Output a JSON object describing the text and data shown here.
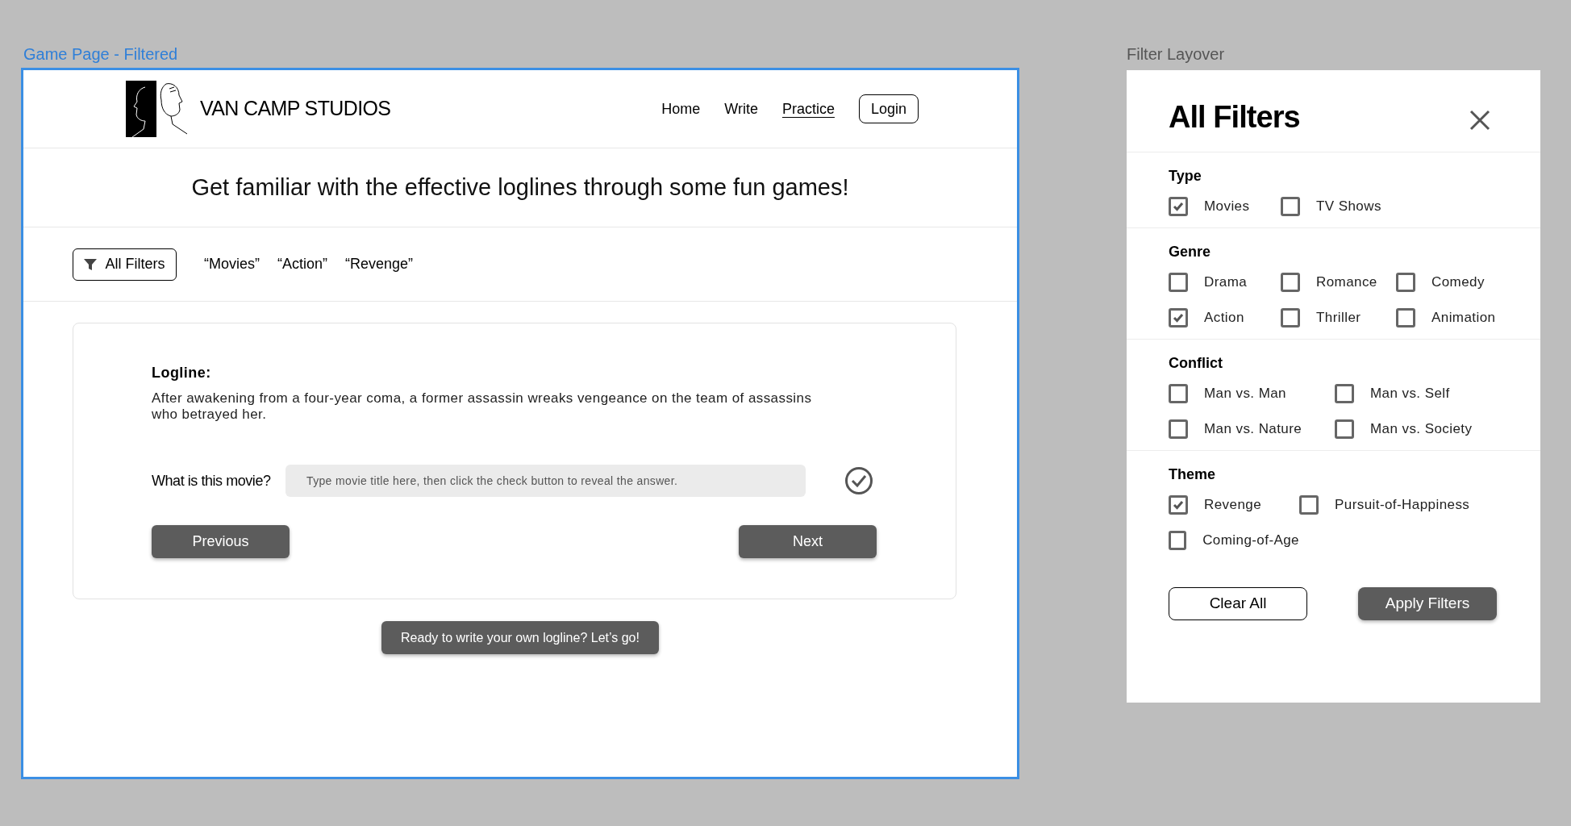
{
  "game_page": {
    "frame_label": "Game Page - Filtered",
    "header": {
      "brand": "VAN CAMP STUDIOS",
      "nav": [
        {
          "label": "Home",
          "selected": false
        },
        {
          "label": "Write",
          "selected": false
        },
        {
          "label": "Practice",
          "selected": true
        }
      ],
      "login": "Login"
    },
    "headline": "Get familiar with the effective loglines through some fun games!",
    "filter_bar": {
      "button": "All Filters",
      "tags": [
        "“Movies”",
        "“Action”",
        "“Revenge”"
      ]
    },
    "card": {
      "logline_label": "Logline:",
      "logline": "After awakening from a four-year coma, a former assassin wreaks vengeance on the team of assassins who betrayed her.",
      "question": "What is this movie?",
      "placeholder": "Type movie title here, then click the check button to reveal the answer.",
      "buttons": [
        "Previous",
        "Next"
      ]
    },
    "cta": "Ready to write your own logline? Let’s go!"
  },
  "filter_layover": {
    "frame_label": "Filter Layover",
    "title": "All Filters",
    "sections": [
      {
        "heading": "Type",
        "options": [
          {
            "label": "Movies",
            "checked": true
          },
          {
            "label": "TV Shows",
            "checked": false
          }
        ]
      },
      {
        "heading": "Genre",
        "options": [
          {
            "label": "Drama",
            "checked": false
          },
          {
            "label": "Romance",
            "checked": false
          },
          {
            "label": "Comedy",
            "checked": false
          },
          {
            "label": "Action",
            "checked": true
          },
          {
            "label": "Thriller",
            "checked": false
          },
          {
            "label": "Animation",
            "checked": false
          }
        ]
      },
      {
        "heading": "Conflict",
        "options": [
          {
            "label": "Man vs. Man",
            "checked": false
          },
          {
            "label": "Man vs. Self",
            "checked": false
          },
          {
            "label": "Man vs. Nature",
            "checked": false
          },
          {
            "label": "Man vs. Society",
            "checked": false
          }
        ]
      },
      {
        "heading": "Theme",
        "options": [
          {
            "label": "Revenge",
            "checked": true
          },
          {
            "label": "Pursuit-of-Happiness",
            "checked": false
          },
          {
            "label": "Coming-of-Age",
            "checked": false
          }
        ]
      }
    ],
    "buttons": [
      {
        "label": "Clear All",
        "kind": "outline"
      },
      {
        "label": "Apply Filters",
        "kind": "filled"
      }
    ]
  }
}
